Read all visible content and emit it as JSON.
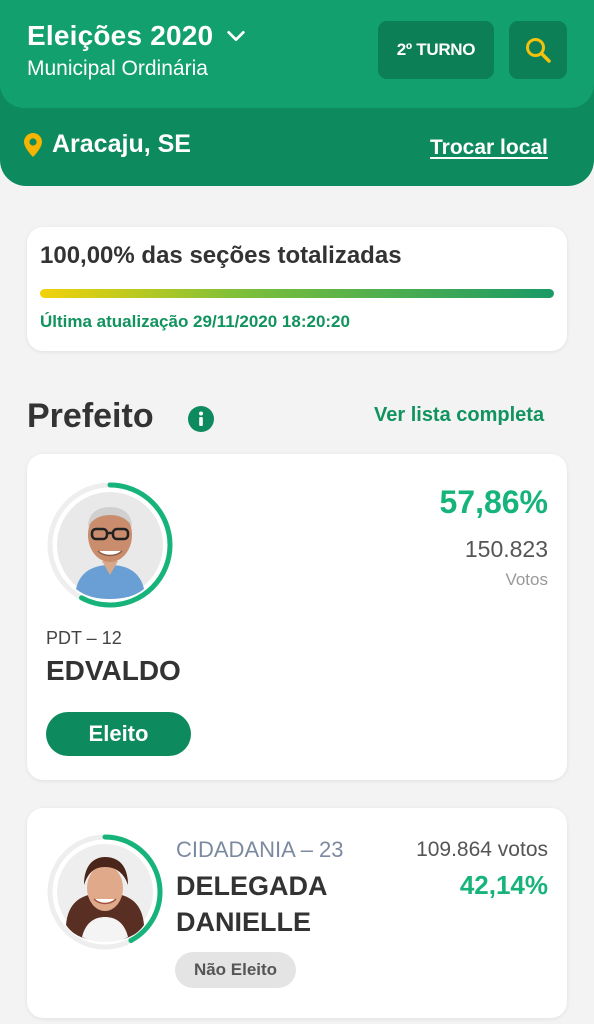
{
  "header": {
    "title": "Eleições 2020",
    "subtitle": "Municipal Ordinária",
    "turno_label": "2º TURNO",
    "location": "Aracaju, SE",
    "change_location": "Trocar local"
  },
  "progress": {
    "title": "100,00% das seções totalizadas",
    "fraction": 1.0,
    "updated": "Última atualização 29/11/2020 18:20:20"
  },
  "section": {
    "title": "Prefeito",
    "see_all": "Ver lista completa"
  },
  "candidates": [
    {
      "party": "PDT – 12",
      "name": "EDVALDO",
      "percent": "57,86%",
      "percent_value": 0.5786,
      "votes": "150.823",
      "votes_label": "Votos",
      "status": "Eleito"
    },
    {
      "party": "CIDADANIA – 23",
      "name": "DELEGADA DANIELLE",
      "percent": "42,14%",
      "percent_value": 0.4214,
      "votes": "109.864 votos",
      "status": "Não Eleito"
    }
  ],
  "colors": {
    "header_dark": "#0e8a5f",
    "header_light": "#12a06e",
    "accent_green": "#16b37a",
    "location_pin": "#f4b400",
    "search_icon": "#f4c20d"
  },
  "icons": {
    "chevron": "chevron-down-icon",
    "search": "search-icon",
    "location": "location-pin-icon",
    "info": "info-icon"
  }
}
